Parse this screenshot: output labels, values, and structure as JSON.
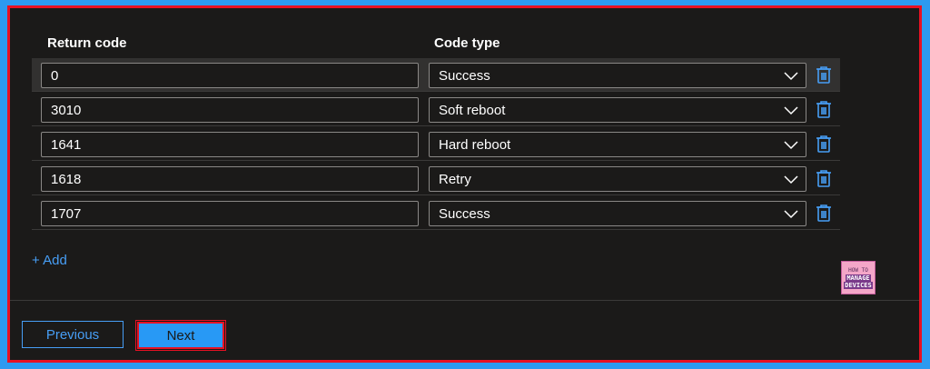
{
  "headers": {
    "return_code": "Return code",
    "code_type": "Code type"
  },
  "rows": [
    {
      "code": "0",
      "type": "Success"
    },
    {
      "code": "3010",
      "type": "Soft reboot"
    },
    {
      "code": "1641",
      "type": "Hard reboot"
    },
    {
      "code": "1618",
      "type": "Retry"
    },
    {
      "code": "1707",
      "type": "Success"
    }
  ],
  "add_label": "+ Add",
  "logo": {
    "line1": "HOW TO",
    "line2": "MANAGE",
    "line3": "DEVICES"
  },
  "buttons": {
    "previous": "Previous",
    "next": "Next"
  },
  "colors": {
    "accent": "#479ef5",
    "primary_button": "#2899f5",
    "highlight_border": "#e81123",
    "background": "#1b1a19"
  },
  "icons": {
    "delete": "trash-icon",
    "dropdown": "chevron-down-icon"
  }
}
